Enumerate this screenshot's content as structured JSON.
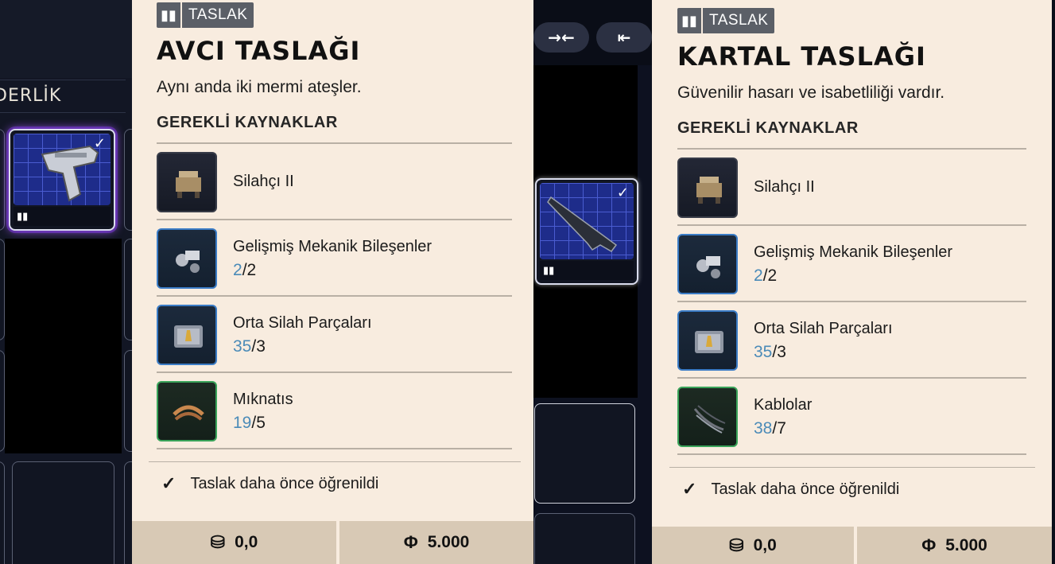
{
  "left_section": {
    "title": "DERLİK"
  },
  "middle_controls": {
    "collapse_label": "→←",
    "merge_label": "⇤"
  },
  "panels": [
    {
      "badge": "TASLAK",
      "title": "AVCI TASLAĞI",
      "description": "Aynı anda iki mermi ateşler.",
      "requirements_title": "GEREKLİ KAYNAKLAR",
      "resources": [
        {
          "name": "Silahçı II",
          "have": "",
          "need": "",
          "icon": "workbench-icon"
        },
        {
          "name": "Gelişmiş Mekanik Bileşenler",
          "have": "2",
          "need": "/2",
          "icon": "mechanical-parts-icon"
        },
        {
          "name": "Orta Silah Parçaları",
          "have": "35",
          "need": "/3",
          "icon": "weapon-case-icon"
        },
        {
          "name": "Mıknatıs",
          "have": "19",
          "need": "/5",
          "icon": "magnet-icon"
        }
      ],
      "learned_text": "Taslak daha önce öğrenildi",
      "weight": "0,0",
      "price": "5.000"
    },
    {
      "badge": "TASLAK",
      "title": "KARTAL TASLAĞI",
      "description": "Güvenilir hasarı ve isabetliliği vardır.",
      "requirements_title": "GEREKLİ KAYNAKLAR",
      "resources": [
        {
          "name": "Silahçı II",
          "have": "",
          "need": "",
          "icon": "workbench-icon"
        },
        {
          "name": "Gelişmiş Mekanik Bileşenler",
          "have": "2",
          "need": "/2",
          "icon": "mechanical-parts-icon"
        },
        {
          "name": "Orta Silah Parçaları",
          "have": "35",
          "need": "/3",
          "icon": "weapon-case-icon"
        },
        {
          "name": "Kablolar",
          "have": "38",
          "need": "/7",
          "icon": "cables-icon"
        }
      ],
      "learned_text": "Taslak daha önce öğrenildi",
      "weight": "0,0",
      "price": "5.000"
    }
  ],
  "colors": {
    "panel_bg": "#f8ecdf",
    "have_count": "#4b8bb8",
    "footer_bg": "#d8c9b5",
    "rarity_blue": "#3b7cc6",
    "rarity_green": "#3aa45a"
  }
}
